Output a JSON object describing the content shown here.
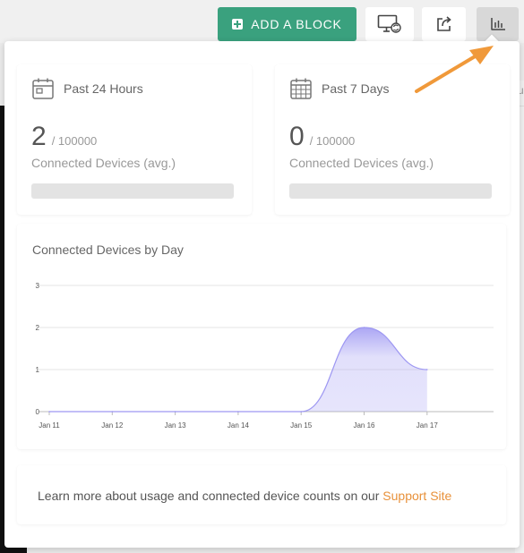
{
  "toolbar": {
    "add_block_label": "ADD A BLOCK",
    "accent_color": "#3aa17e"
  },
  "stats": [
    {
      "period": "Past 24 Hours",
      "icon": "calendar-icon",
      "value": "2",
      "max": "/ 100000",
      "label": "Connected Devices (avg.)"
    },
    {
      "period": "Past 7 Days",
      "icon": "calendar-grid-icon",
      "value": "0",
      "max": "/ 100000",
      "label": "Connected Devices (avg.)"
    }
  ],
  "chart_data": {
    "type": "area",
    "title": "Connected Devices by Day",
    "x": [
      "Jan 11",
      "Jan 12",
      "Jan 13",
      "Jan 14",
      "Jan 15",
      "Jan 16",
      "Jan 17"
    ],
    "values": [
      0,
      0,
      0,
      0,
      0,
      2,
      1
    ],
    "ylim": [
      0,
      3
    ],
    "yticks": [
      "0",
      "1",
      "2",
      "3"
    ],
    "grid": true,
    "legend": "none",
    "series_color": "#9d97f2"
  },
  "footer": {
    "text": "Learn more about usage and connected device counts on our",
    "link": "Support Site",
    "link_color": "#e8913a"
  },
  "annotation": {
    "arrow_color": "#f0993a"
  }
}
